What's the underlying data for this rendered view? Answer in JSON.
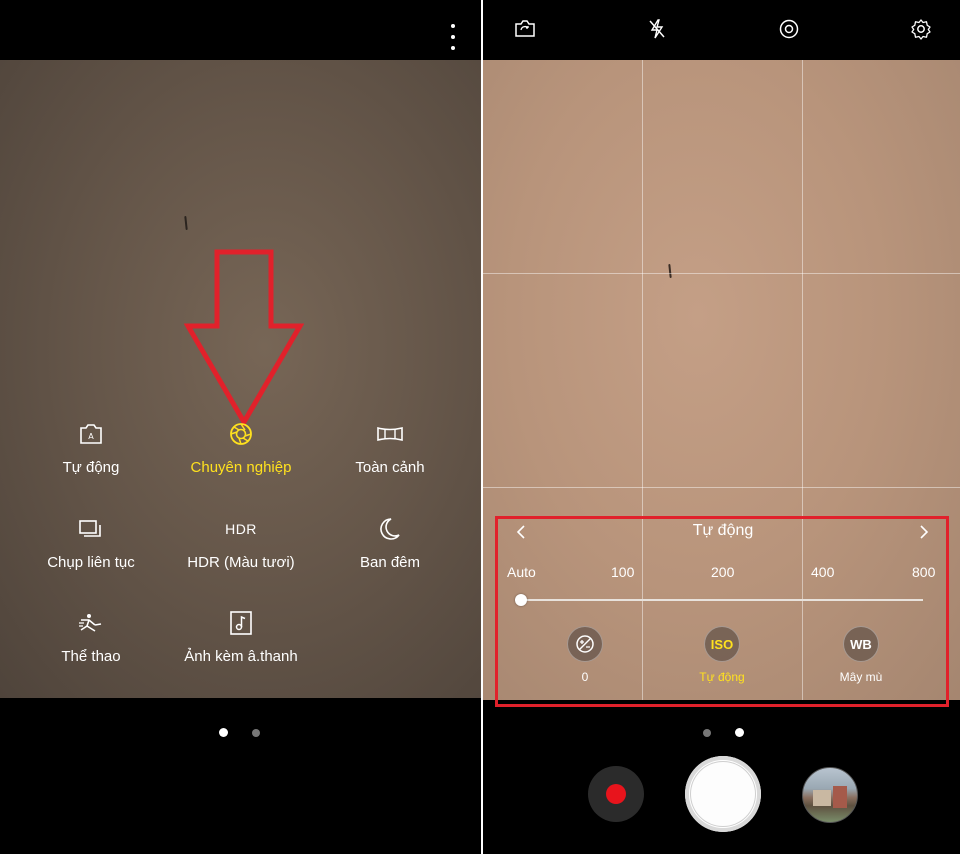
{
  "left_screen": {
    "modes": [
      {
        "label": "Tự động",
        "icon": "auto-camera-icon"
      },
      {
        "label": "Chuyên nghiệp",
        "icon": "aperture-icon",
        "active": true
      },
      {
        "label": "Toàn cảnh",
        "icon": "panorama-icon"
      },
      {
        "label": "Chụp liên tục",
        "icon": "burst-shot-icon"
      },
      {
        "label": "HDR (Màu tươi)",
        "icon": "hdr-icon",
        "icon_text": "HDR"
      },
      {
        "label": "Ban đêm",
        "icon": "moon-icon"
      },
      {
        "label": "Thể thao",
        "icon": "sports-icon"
      },
      {
        "label": "Ảnh kèm â.thanh",
        "icon": "sound-shot-icon"
      }
    ],
    "page_indicator": {
      "count": 2,
      "current": 1
    }
  },
  "right_screen": {
    "top_icons": [
      "switch-camera-icon",
      "flash-off-icon",
      "timer-icon",
      "settings-gear-icon"
    ],
    "iso_panel": {
      "title": "Tự động",
      "values": [
        "Auto",
        "100",
        "200",
        "400",
        "800"
      ],
      "selected_fraction": 0
    },
    "controls": [
      {
        "name": "exposure",
        "icon": "exposure-icon",
        "label": "0"
      },
      {
        "name": "iso",
        "icon_text": "ISO",
        "label": "Tự động",
        "active": true
      },
      {
        "name": "white-balance",
        "icon_text": "WB",
        "label": "Mây mù"
      }
    ],
    "page_indicator": {
      "count": 2,
      "current": 2
    }
  },
  "colors": {
    "accent_yellow": "#ffe11e",
    "highlight_red": "#e1212b",
    "record_red": "#e8141c"
  }
}
